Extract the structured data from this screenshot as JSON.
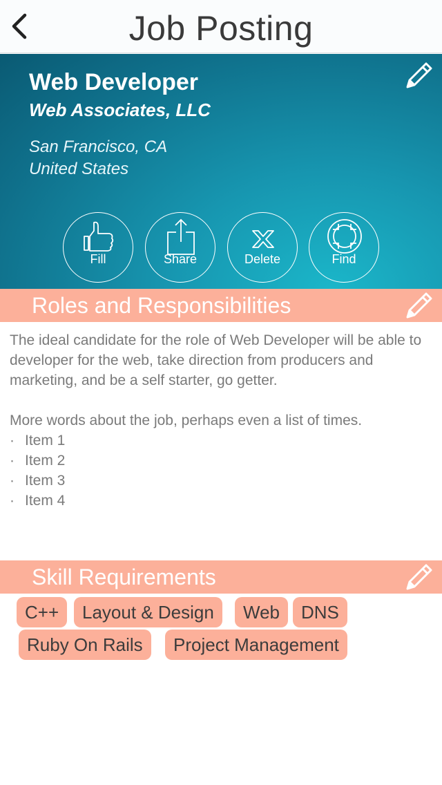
{
  "nav": {
    "title": "Job Posting",
    "back_icon": "chevron-left-icon"
  },
  "job": {
    "title": "Web Developer",
    "company": "Web Associates, LLC",
    "city": "San Francisco, CA",
    "country": "United States"
  },
  "actions": [
    {
      "label": "Fill",
      "icon": "thumbs-up-icon"
    },
    {
      "label": "Share",
      "icon": "share-icon"
    },
    {
      "label": "Delete",
      "icon": "x-icon"
    },
    {
      "label": "Find",
      "icon": "crosshair-icon"
    }
  ],
  "roles": {
    "title": "Roles and Responsibilities",
    "paragraph1": "The ideal candidate for the role of Web Developer will be able to developer for the web, take direction from producers and marketing, and be a self starter, go getter.",
    "paragraph2": "More words about the job, perhaps even a list of times.",
    "bullet_char": "·",
    "items": [
      "Item 1",
      "Item 2",
      "Item 3",
      "Item 4"
    ]
  },
  "skills": {
    "title": "Skill Requirements",
    "tags": [
      "C++",
      "Layout & Design",
      "Web",
      "DNS",
      "Ruby On Rails",
      "Project Management"
    ]
  },
  "colors": {
    "accent": "#fcb09a",
    "hero_teal": "#1796b0",
    "body_text": "#7a7a7a"
  }
}
